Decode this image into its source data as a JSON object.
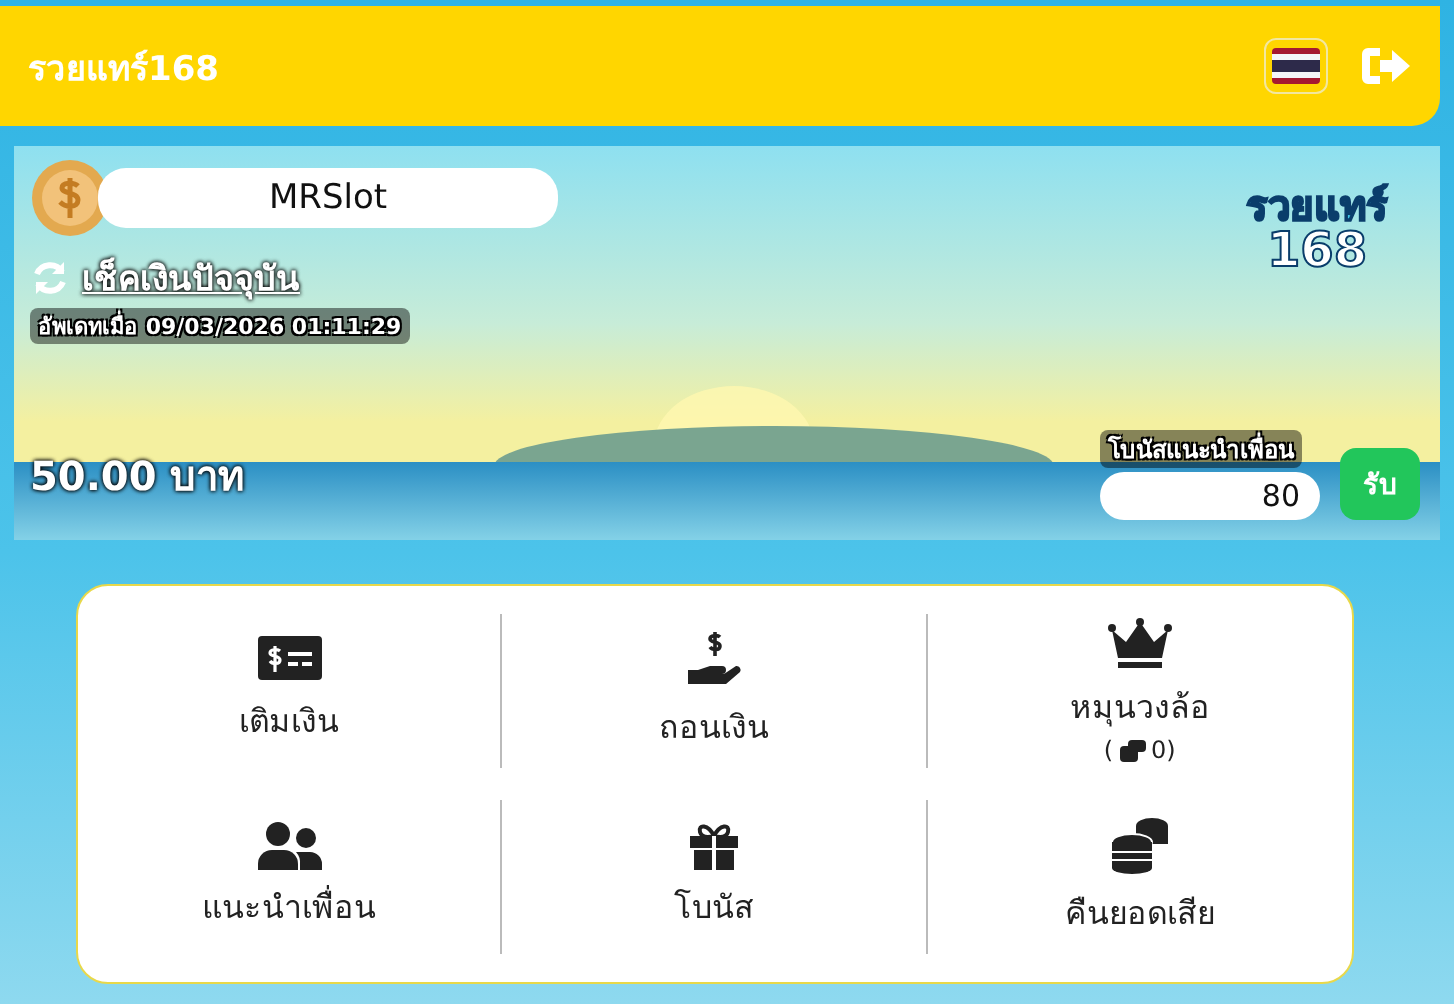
{
  "header": {
    "title": "รวยแทร์168"
  },
  "banner": {
    "username": "MRSlot",
    "check_link": "เช็คเงินปัจจุบัน",
    "updated": "อัพเดทเมื่อ 09/03/2026 01:11:29",
    "balance": "50.00 บาท",
    "logo": {
      "line1": "รวยแทร์",
      "line2": "168"
    },
    "referral_label": "โบนัสแนะนำเพื่อน",
    "referral_value": "80",
    "claim_button": "รับ"
  },
  "menu": [
    {
      "label": "เติมเงิน"
    },
    {
      "label": "ถอนเงิน"
    },
    {
      "label": "หมุนวงล้อ",
      "count_open": "(",
      "count": "0)"
    },
    {
      "label": "แนะนำเพื่อน"
    },
    {
      "label": "โบนัส"
    },
    {
      "label": "คืนยอดเสีย"
    }
  ]
}
